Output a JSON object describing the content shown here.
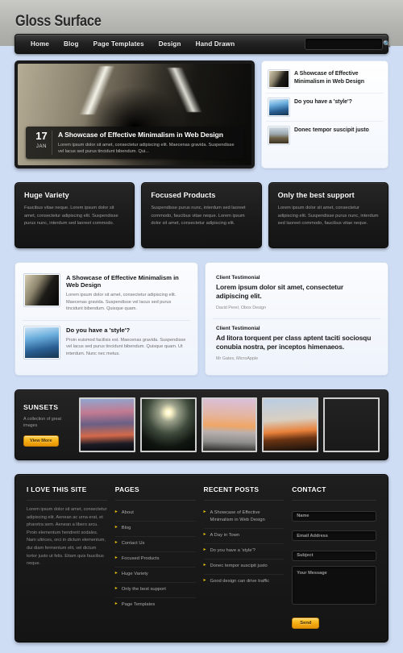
{
  "site": {
    "title": "Gloss Surface"
  },
  "nav": {
    "items": [
      "Home",
      "Blog",
      "Page Templates",
      "Design",
      "Hand Drawn"
    ],
    "search_placeholder": "",
    "search_value": "",
    "search_icon": "search-icon"
  },
  "slider": {
    "day": "17",
    "month": "JAN",
    "title": "A Showcase of Effective Minimalism in Web Design",
    "excerpt": "Lorem ipsum dolor sit amet, consectetur adipiscing elit. Maecenas gravida. Suspendisse vel lacus sed purus tincidunt bibendum. Qui..."
  },
  "featured_list": [
    {
      "title": "A Showcase of Effective Minimalism in Web Design",
      "thumb": "thumb-tunnel"
    },
    {
      "title": "Do you have a 'style'?",
      "thumb": "thumb-blue"
    },
    {
      "title": "Donec tempor suscipit justo",
      "thumb": "thumb-beach"
    }
  ],
  "boxes": [
    {
      "title": "Huge Variety",
      "text": "Faucibus vitae neque. Lorem ipsum dolor sit amet, consectetur adipiscing elit. Suspendisse purus nunc, interdum sed laoreet commodo."
    },
    {
      "title": "Focused Products",
      "text": "Suspendisse purus nunc, interdum sed laoreet commodo, faucibus vitae neque. Lorem ipsum dolor sit amet, consectetur adipiscing elit."
    },
    {
      "title": "Only the best support",
      "text": "Lorem ipsum dolor sit amet, consectetur adipiscing elit. Suspendisse purus nunc, interdum sed laoreet commodo, faucibus vitae neque."
    }
  ],
  "posts": [
    {
      "title": "A Showcase of Effective Minimalism in Web Design",
      "text": "Lorem ipsum dolor sit amet, consectetur adipiscing elit. Maecenas gravida. Suspendisse vel lacus sed purus tincidunt bibendum. Quisque quam.",
      "thumb": "thumb-tunnel"
    },
    {
      "title": "Do you have a 'style'?",
      "text": "Proin euismod facilisis est. Maecenas gravida. Suspendisse vel lacus sed purus tincidunt bibendum. Quisque quam. Ut interdum. Nunc nec metus.",
      "thumb": "thumb-blue"
    }
  ],
  "testimonials": [
    {
      "label": "Client Testimonial",
      "quote": "Lorem ipsum dolor sit amet, consectetur adipiscing elit.",
      "author": "David Perel, Obox Design"
    },
    {
      "label": "Client Testimonial",
      "quote": "Ad litora torquent per class aptent taciti sociosqu conubia nostra, per inceptos himenaeos.",
      "author": "Mr Gates, MicroApple"
    }
  ],
  "gallery": {
    "title": "SUNSETS",
    "subtitle": "A collection of great images",
    "button": "View More",
    "images": [
      "g1",
      "g2",
      "g3",
      "g4",
      "g5"
    ]
  },
  "footer": {
    "about": {
      "title": "I LOVE THIS SITE",
      "text": "Lorem ipsum dolor sit amet, consectetur adipiscing elit. Aenean ac urna erat, et pharetra sem. Aenean a libero arcu. Proin elementum hendrerit sodales. Nam ultrices, orci in dictum elementum, dui diam fermentum elit, vel dictum tortor justo ut felis. Etiam quis faucibus neque."
    },
    "pages": {
      "title": "PAGES",
      "items": [
        "About",
        "Blog",
        "Contact Us",
        "Focused Products",
        "Huge Variety",
        "Only the best support",
        "Page Templates"
      ]
    },
    "recent": {
      "title": "RECENT POSTS",
      "items": [
        "A Showcase of Effective Minimalism in Web Design",
        "A Day in Town",
        "Do you have a 'style'?",
        "Donec tempor suscipit justo",
        "Good design can drive traffic"
      ]
    },
    "contact": {
      "title": "CONTACT",
      "name_placeholder": "Name",
      "email_placeholder": "Email Address",
      "subject_placeholder": "Subject",
      "message_placeholder": "Your Message",
      "send_label": "Send"
    }
  },
  "colors": {
    "page_background": "#cfddf4",
    "header_background": "#b2b2ae",
    "dark_panel": "#1a1a1a",
    "accent_gold": "#f4ab10",
    "link_arrow": "#e8c20d"
  }
}
